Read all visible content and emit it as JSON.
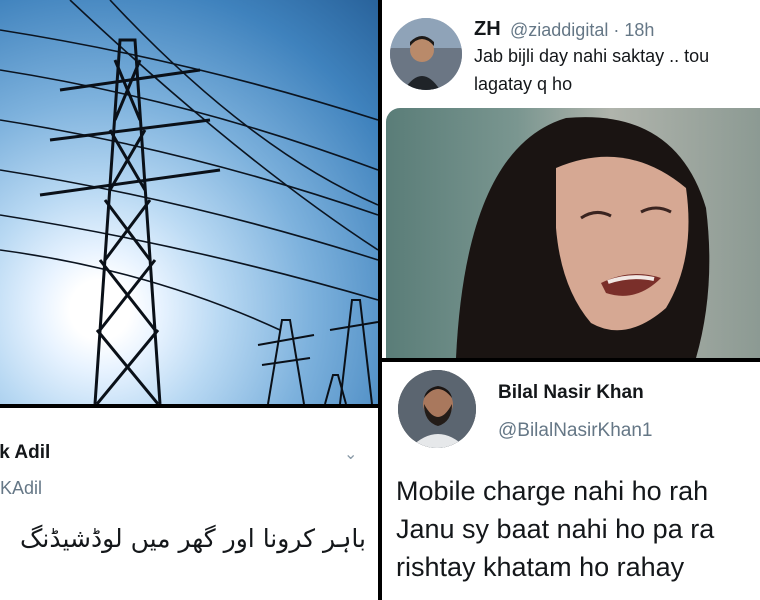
{
  "panels": {
    "power_photo": {
      "icon": "power-lines-image"
    },
    "tweet_left": {
      "name": "ik Adil",
      "handle": "lKAdil",
      "text": "باہر کرونا اور گھر میں لوڈشیڈنگ",
      "menu_icon": "chevron-down-icon"
    },
    "tweet_top_right": {
      "name": "ZH",
      "handle": "@ziaddigital · 18h",
      "text_line1": "Jab bijli day nahi saktay .. tou",
      "text_line2": "lagatay q ho",
      "avatar_icon": "avatar",
      "media_icon": "crying-woman-image"
    },
    "tweet_bottom_right": {
      "name": "Bilal Nasir Khan",
      "handle": "@BilalNasirKhan1",
      "line1": "Mobile charge nahi ho rah",
      "line2": "Janu sy baat nahi ho pa ra",
      "line3": "rishtay khatam ho rahay",
      "avatar_icon": "avatar"
    }
  },
  "colors": {
    "text": "#14171a",
    "secondary": "#657786",
    "divider": "#000000"
  }
}
